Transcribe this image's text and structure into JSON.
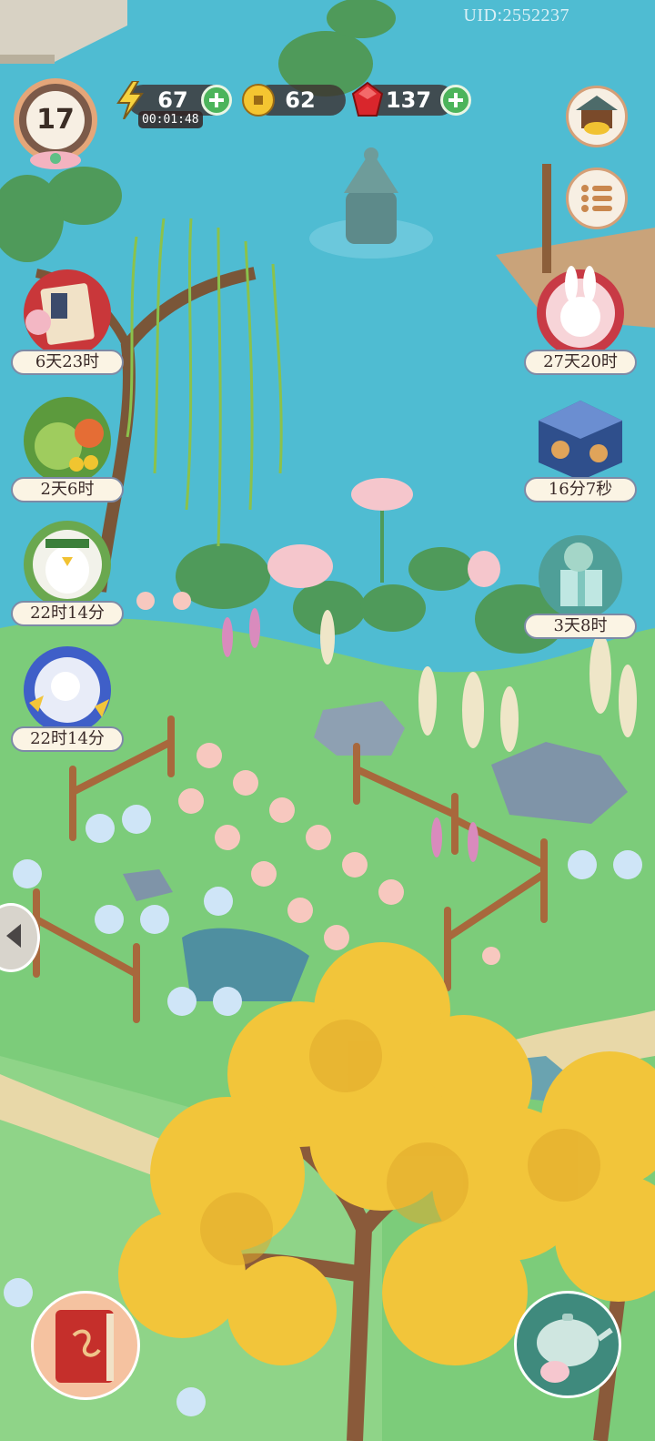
{
  "uid": "UID:2552237",
  "level": "17",
  "resources": {
    "energy": {
      "value": "67",
      "timer": "00:01:48"
    },
    "coins": {
      "value": "62"
    },
    "gems": {
      "value": "137"
    }
  },
  "left_events": [
    {
      "timer": "6天23时",
      "icon": "gift-bundle-icon"
    },
    {
      "timer": "2天6时",
      "icon": "cabbage-carrot-icon"
    },
    {
      "timer": "22时14分",
      "icon": "bird-mascot-icon"
    },
    {
      "timer": "22时14分",
      "icon": "cat-mascot-icon"
    }
  ],
  "right_events": [
    {
      "timer": "27天20时",
      "icon": "rabbit-icon"
    },
    {
      "timer": "16分7秒",
      "icon": "blue-box-icon"
    },
    {
      "timer": "3天8时",
      "icon": "gift-cat-icon"
    }
  ],
  "colors": {
    "water": "#4fbcd2",
    "grass": "#7ccc7a",
    "ginkgo": "#f2c53a"
  }
}
